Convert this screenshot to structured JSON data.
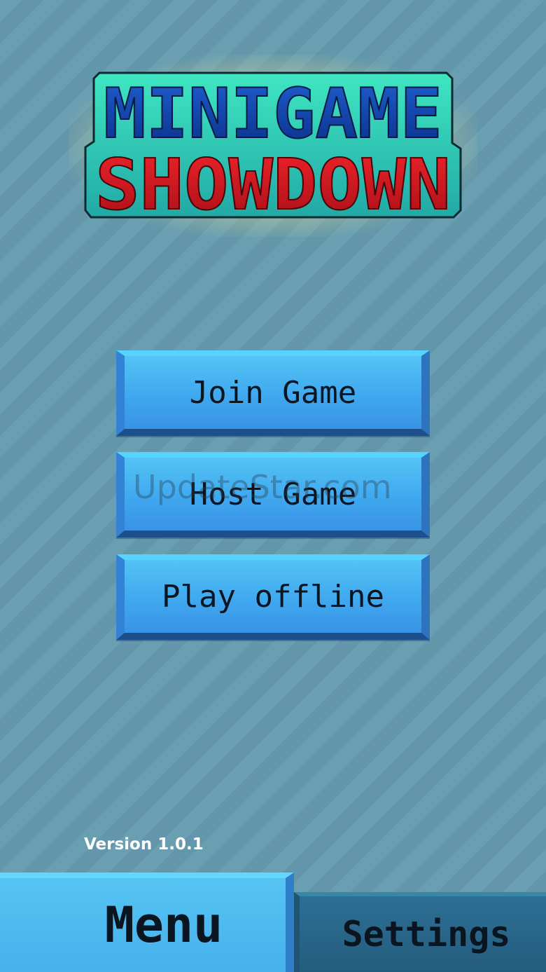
{
  "logo": {
    "line1": "MINIGAME",
    "line2": "SHOWDOWN",
    "colors": {
      "frame": "#2fc4b0",
      "glow": "#fff08c",
      "line1_fill": "#0d3ea8",
      "line2_fill": "#d4161e"
    }
  },
  "menu": {
    "buttons": [
      {
        "label": "Join Game"
      },
      {
        "label": "Host Game"
      },
      {
        "label": "Play offline"
      }
    ]
  },
  "watermark": "UpdateStar.com",
  "version": "Version 1.0.1",
  "tabs": {
    "menu": "Menu",
    "settings": "Settings",
    "active": "Menu"
  },
  "colors": {
    "background": "#6a9fb1",
    "button": "#3fa8ef",
    "tab_active": "#4fbdf2",
    "tab_inactive": "#2a6790"
  }
}
